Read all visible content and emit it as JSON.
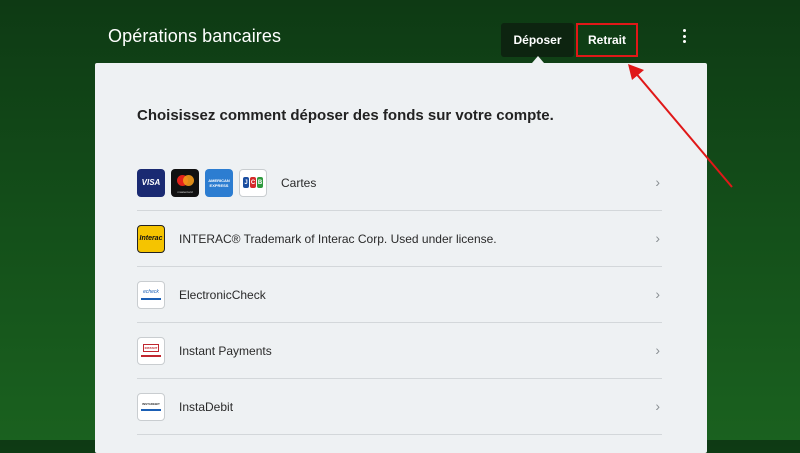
{
  "header": {
    "title": "Opérations bancaires",
    "tabs": [
      {
        "label": "Déposer",
        "active": true
      },
      {
        "label": "Retrait",
        "active": false
      }
    ],
    "more_icon": "vertical-ellipsis-icon"
  },
  "panel": {
    "heading": "Choisissez comment déposer des fonds sur votre compte.",
    "methods": [
      {
        "label": "Cartes",
        "icons": [
          "visa-logo",
          "mastercard-logo",
          "american-express-logo",
          "jcb-logo"
        ]
      },
      {
        "label": "INTERAC® Trademark of Interac Corp. Used under license.",
        "icons": [
          "interac-logo"
        ]
      },
      {
        "label": "ElectronicCheck",
        "icons": [
          "echeck-logo"
        ]
      },
      {
        "label": "Instant Payments",
        "icons": [
          "instant-payments-logo"
        ]
      },
      {
        "label": "InstaDebit",
        "icons": [
          "instadebit-logo"
        ]
      }
    ],
    "chevron_icon": "chevron-right-icon"
  },
  "logo_text": {
    "visa": "VISA",
    "interac": "Interac",
    "echeck": "echeck",
    "instant": "INSTANT",
    "instadebit": "INSTADEBIT",
    "mastercard": "mastercard",
    "amex": "AMERICAN EXPRESS",
    "jcb": [
      "J",
      "C",
      "B"
    ]
  },
  "colors": {
    "background": "#134d19",
    "panel": "#eef1f3",
    "active_tab": "#0d2410",
    "highlight": "#e01818"
  }
}
